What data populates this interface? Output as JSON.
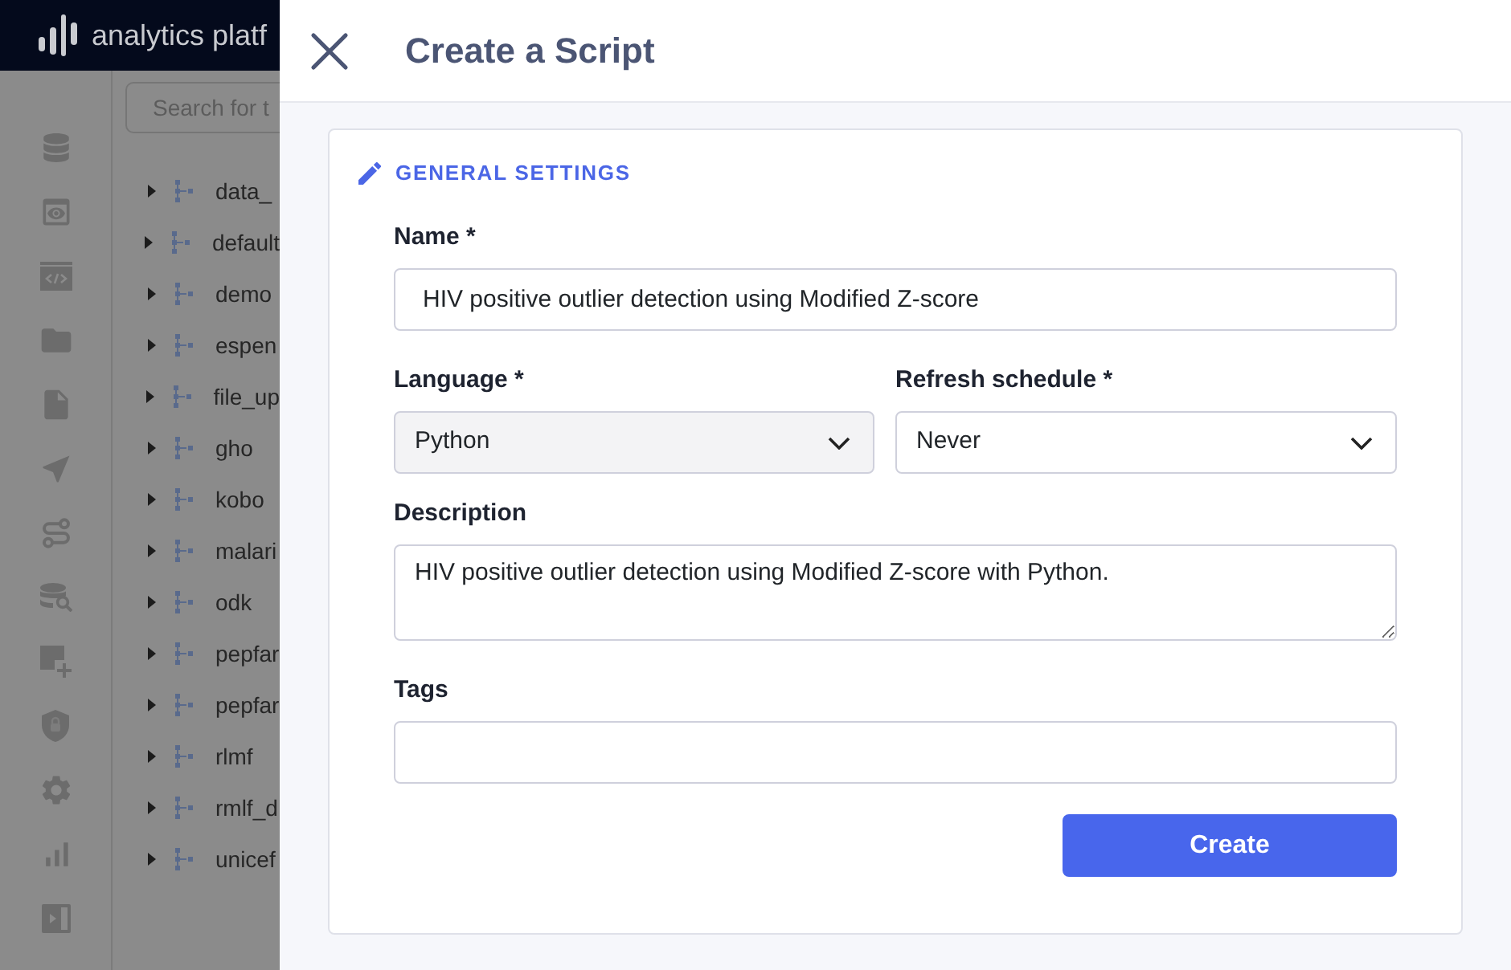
{
  "app_header": {
    "logo_text": "analytics platf"
  },
  "sidebar": {
    "search": {
      "placeholder": "Search for t"
    },
    "tree": [
      {
        "label": "data_",
        "expanded": false
      },
      {
        "label": "default",
        "expanded": false
      },
      {
        "label": "demo",
        "expanded": false
      },
      {
        "label": "espen",
        "expanded": false
      },
      {
        "label": "file_up",
        "expanded": false
      },
      {
        "label": "gho",
        "expanded": false
      },
      {
        "label": "kobo",
        "expanded": false
      },
      {
        "label": "malari",
        "expanded": false
      },
      {
        "label": "odk",
        "expanded": false
      },
      {
        "label": "pepfar",
        "expanded": false
      },
      {
        "label": "pepfar",
        "expanded": false
      },
      {
        "label": "rlmf",
        "expanded": false
      },
      {
        "label": "rmlf_d",
        "expanded": false
      },
      {
        "label": "unicef",
        "expanded": false
      }
    ]
  },
  "drawer": {
    "title": "Create a Script",
    "section_title": "GENERAL SETTINGS",
    "form": {
      "rows": [
        [
          {
            "kind": "text",
            "label": "Name *",
            "value": "HIV positive outlier detection using Modified Z-score"
          }
        ],
        [
          {
            "kind": "select",
            "label": "Language *",
            "value": "Python",
            "disabled": true
          },
          {
            "kind": "select",
            "label": "Refresh schedule *",
            "value": "Never",
            "disabled": false
          }
        ],
        [
          {
            "kind": "textarea",
            "label": "Description",
            "value": "HIV positive outlier detection using Modified Z-score with Python."
          }
        ],
        [
          {
            "kind": "text",
            "label": "Tags"
          }
        ]
      ]
    },
    "submit_button": "Create"
  }
}
